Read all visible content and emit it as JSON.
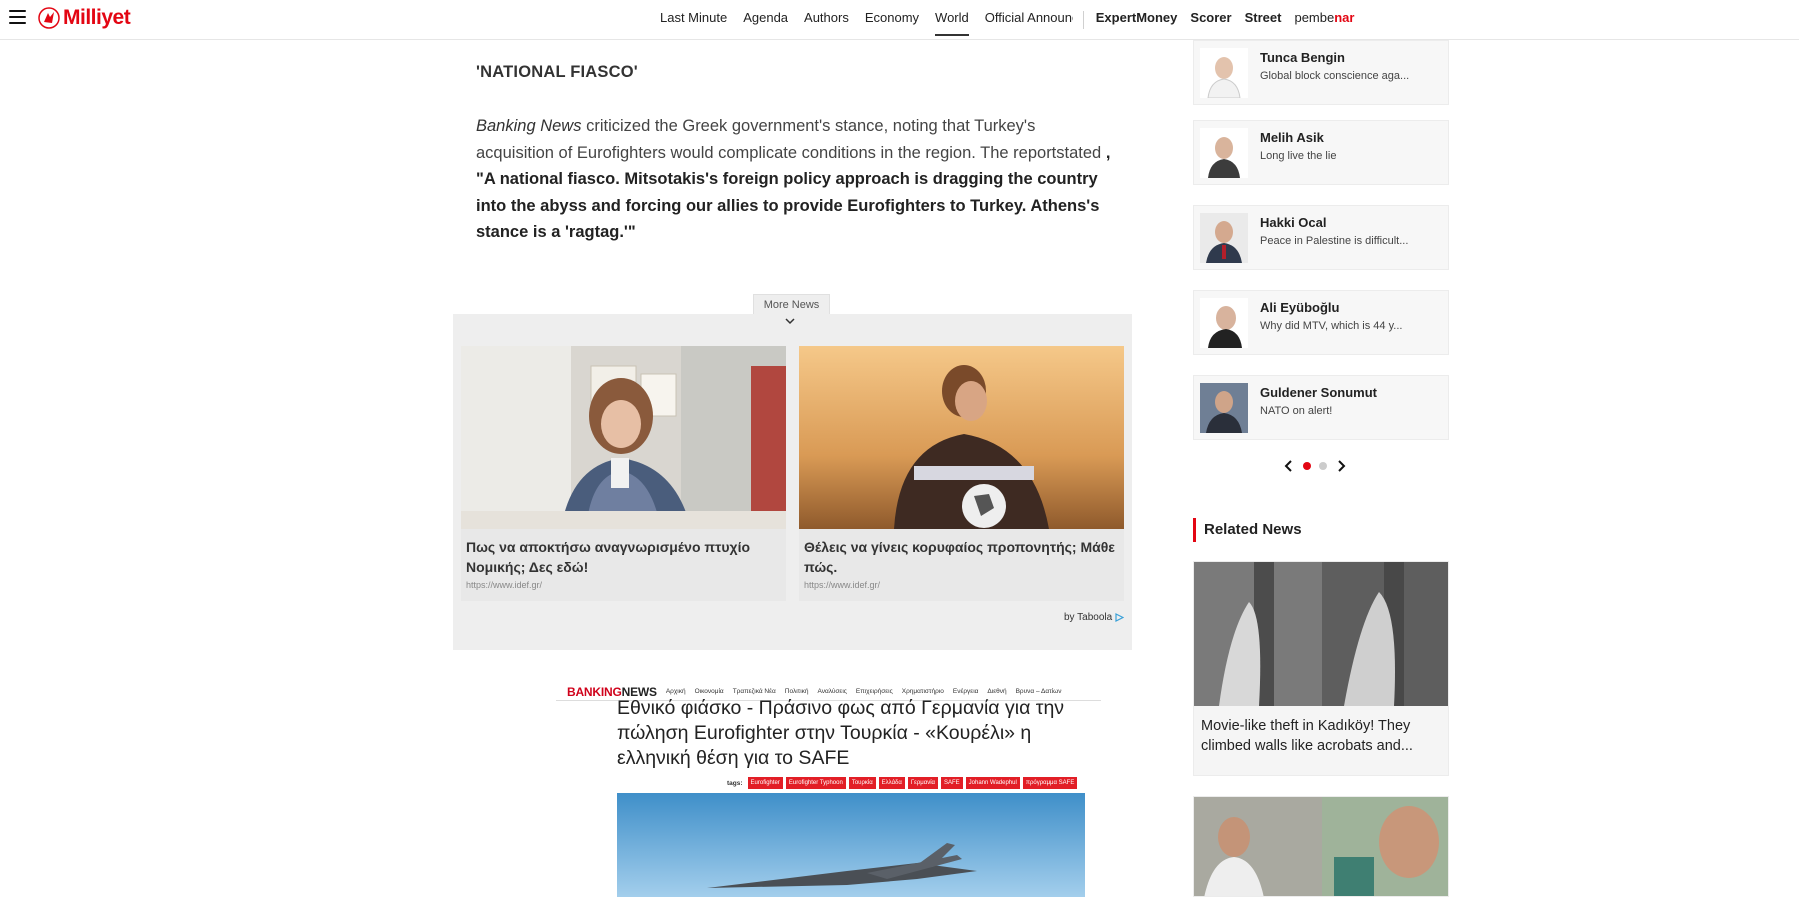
{
  "header": {
    "logo_text": "Milliyet",
    "nav": [
      {
        "label": "Last Minute"
      },
      {
        "label": "Agenda"
      },
      {
        "label": "Authors"
      },
      {
        "label": "Economy"
      },
      {
        "label": "World",
        "active": true
      },
      {
        "label": "Official Announcements"
      }
    ],
    "nav_secondary": [
      "ExpertMoney",
      "Scorer",
      "Street"
    ],
    "pembenar_prefix": "pembe",
    "pembenar_suffix": "nar"
  },
  "article": {
    "subheading": "'NATIONAL FIASCO'",
    "para_source": "Banking News",
    "para_text": " criticized the Greek government's stance, noting that Turkey's acquisition of Eurofighters would complicate conditions in the region. The reportstated",
    "para_quote": " , \"A national fiasco. Mitsotakis's foreign policy approach is dragging the country into the abyss and forcing our allies to provide Eurofighters to Turkey. Athens's stance is a 'ragtag.'\""
  },
  "more_news": {
    "tab_label": "More News",
    "cards": [
      {
        "title": "Πως να αποκτήσω αναγνωρισμένο πτυχίο Νομικής; Δες εδώ!",
        "url": "https://www.idef.gr/"
      },
      {
        "title": "Θέλεις να γίνεις κορυφαίος προπονητής; Μάθε πώς.",
        "url": "https://www.idef.gr/"
      }
    ],
    "by_label": "by Taboola"
  },
  "embed": {
    "brand_a": "BANKING",
    "brand_b": "NEWS",
    "menu": [
      "Αρχική",
      "Οικονομία",
      "Τραπεζικά Νέα",
      "Πολιτική",
      "Αναλύσεις",
      "Επιχειρήσεις",
      "Χρηματιστήριο",
      "Ενέργεια",
      "Διεθνή",
      "Βρυνα – Δατίων"
    ],
    "headline": "Εθνικό φιάσκο - Πράσινο φως από Γερμανία για την πώληση Eurofighter στην Τουρκία - «Κουρέλι» η ελληνική θέση για το SAFE",
    "tags_label": "tags:",
    "tags": [
      "Eurofighter",
      "Eurofighter Typhoon",
      "Τουρκία",
      "Ελλάδα",
      "Γερμανία",
      "SAFE",
      "Johann Wadephul",
      "πρόγραμμα SAFE"
    ]
  },
  "authors": [
    {
      "name": "Tunca Bengin",
      "text": "Global block conscience aga..."
    },
    {
      "name": "Melih Asik",
      "text": "Long live the lie"
    },
    {
      "name": "Hakki Ocal",
      "text": "Peace in Palestine is difficult..."
    },
    {
      "name": "Ali Eyüboğlu",
      "text": "Why did MTV, which is 44 y..."
    },
    {
      "name": "Guldener Sonumut",
      "text": "NATO on alert!"
    }
  ],
  "pager": {
    "pages": 2,
    "current": 1
  },
  "related": {
    "title": "Related News",
    "items": [
      {
        "text": "Movie-like theft in Kadıköy! They climbed walls like acrobats and..."
      }
    ]
  },
  "colors": {
    "brand_red": "#e30613",
    "panel_grey": "#eeeeee"
  }
}
